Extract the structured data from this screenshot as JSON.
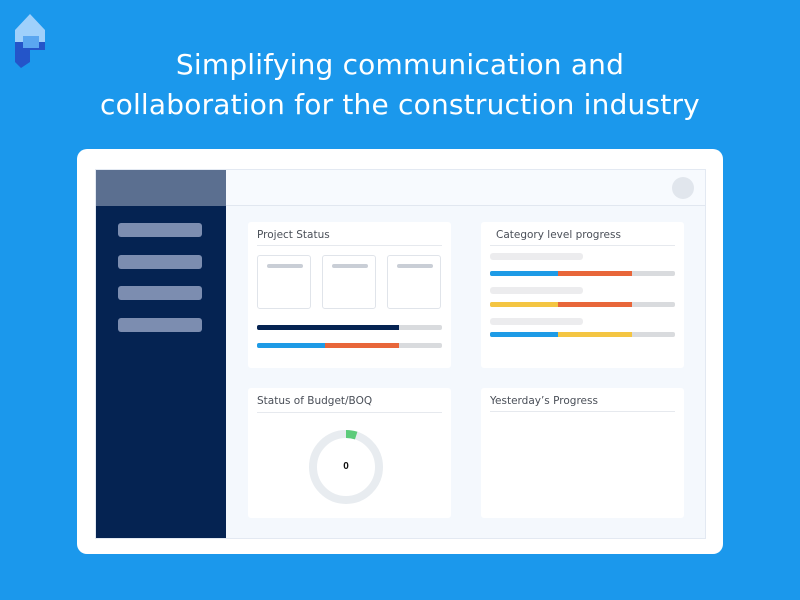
{
  "headline": {
    "line1": "Simplifying communication and",
    "line2": "collaboration for the construction industry"
  },
  "colors": {
    "background": "#1b98ec",
    "sidebar": "#052352",
    "navy": "#052352",
    "blue": "#1e9be6",
    "orange": "#e8663a",
    "yellow": "#f4c542",
    "grey": "#d9dbde",
    "green": "#5ccb7a"
  },
  "icons": {
    "logo": "brand-logo-icon",
    "avatar": "user-avatar-icon"
  },
  "sidebar": {
    "item_count": 4
  },
  "project_status": {
    "title": "Project Status",
    "bars": [
      [
        {
          "color": "navy",
          "fraction": 0.77
        }
      ],
      [
        {
          "color": "blue",
          "fraction": 0.37
        },
        {
          "color": "orange",
          "fraction": 0.4
        }
      ]
    ]
  },
  "category_progress": {
    "title": "Category level progress",
    "bars": [
      [
        {
          "color": "blue",
          "fraction": 0.37
        },
        {
          "color": "orange",
          "fraction": 0.4
        }
      ],
      [
        {
          "color": "yellow",
          "fraction": 0.37
        },
        {
          "color": "orange",
          "fraction": 0.4
        }
      ],
      [
        {
          "color": "blue",
          "fraction": 0.37
        },
        {
          "color": "yellow",
          "fraction": 0.4
        }
      ]
    ]
  },
  "budget": {
    "title": "Status of Budget/BOQ",
    "value": "0",
    "arc_fraction": 0.05
  },
  "yesterday": {
    "title": "Yesterday’s Progress"
  }
}
